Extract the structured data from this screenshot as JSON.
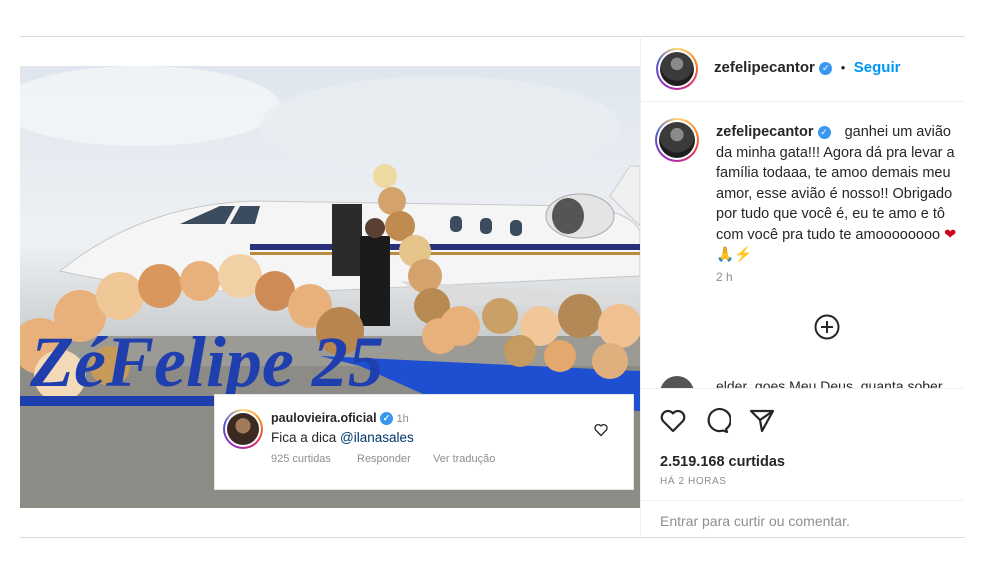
{
  "post_header": {
    "username": "zefelipecantor",
    "separator": "•",
    "follow_label": "Seguir"
  },
  "caption": {
    "username": "zefelipecantor",
    "text": "ganhei um avião da minha gata!!! Agora dá pra levar a família todaaa, te amoo demais meu amor, esse avião é nosso!! Obrigado por tudo que você é, eu te amo e tô com você pra tudo te amoooooooo",
    "emojis": "❤🙏⚡",
    "time": "2 h"
  },
  "partial_comment": {
    "text": "elder_goes Meu Deus, quanta sober"
  },
  "engagement": {
    "likes": "2.519.168 curtidas",
    "posted_ago": "HÁ 2 HORAS"
  },
  "comment_input": {
    "login_link": "Entrar",
    "prompt": "para curtir ou comentar."
  },
  "overlay_comment": {
    "username": "paulovieira.oficial",
    "time": "1h",
    "text_prefix": "Fica a dica",
    "mention": "@ilanasales",
    "likes": "925 curtidas",
    "reply_label": "Responder",
    "translate_label": "Ver tradução"
  },
  "photo": {
    "balloon_sign": "ZéFelipe 25"
  },
  "colors": {
    "accent": "#0095f6",
    "carpet": "#1e4fd0",
    "sign": "#1f3fae"
  },
  "icons": [
    "heart-icon",
    "comment-icon",
    "share-icon",
    "plus-circle-icon",
    "verified-badge-icon"
  ]
}
